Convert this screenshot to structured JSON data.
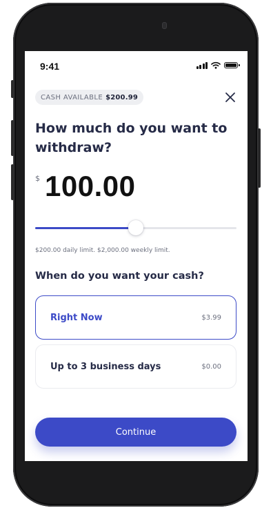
{
  "status_bar": {
    "time": "9:41"
  },
  "header": {
    "cash_available_label": "CASH AVAILABLE",
    "cash_available_amount": "$200.99",
    "close_icon": "close-x-icon"
  },
  "withdraw": {
    "question": "How much do you want to withdraw?",
    "currency_symbol": "$",
    "amount": "100.00",
    "slider_fraction": 0.5,
    "limits_text": "$200.00 daily limit. $2,000.00 weekly limit."
  },
  "timing": {
    "question": "When do you want your cash?",
    "options": [
      {
        "label": "Right Now",
        "price": "$3.99",
        "selected": true
      },
      {
        "label": "Up to 3 business days",
        "price": "$0.00",
        "selected": false
      }
    ]
  },
  "actions": {
    "continue_label": "Continue"
  },
  "colors": {
    "accent": "#3c4ac7",
    "heading": "#262b47",
    "muted": "#6b6f7e",
    "device_frame": "#1b1b1c"
  }
}
